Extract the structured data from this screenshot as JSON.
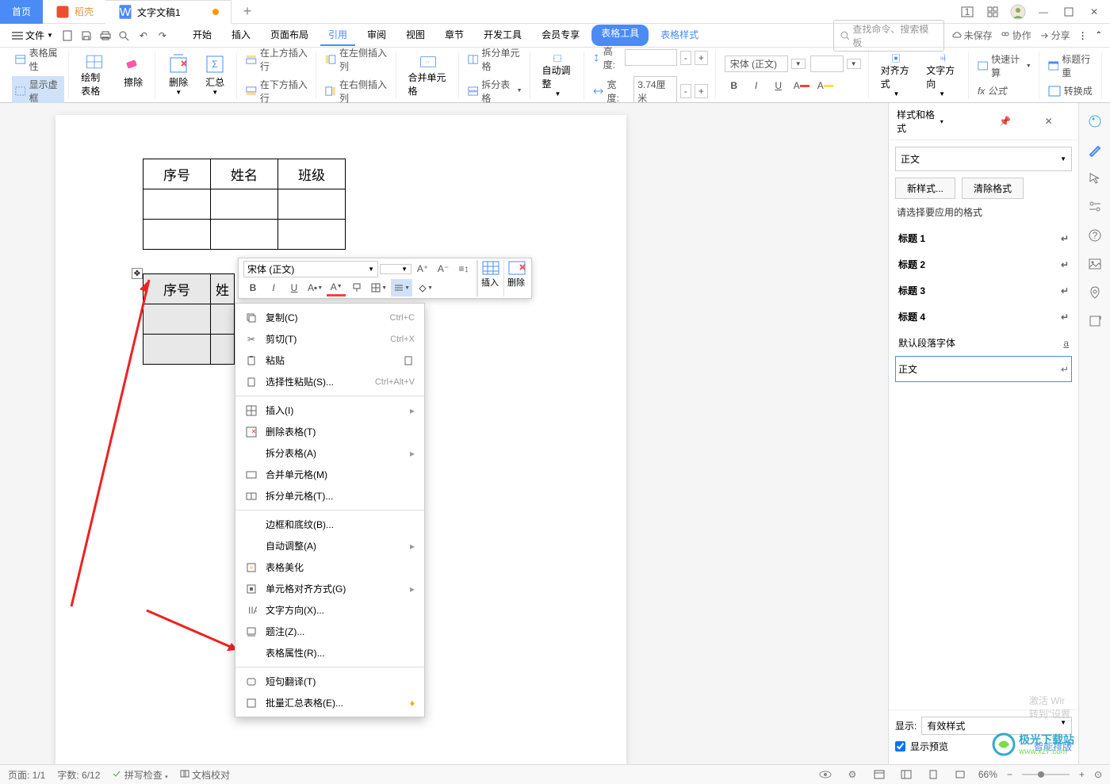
{
  "titlebar": {
    "home": "首页",
    "daoke": "稻壳",
    "doc_title": "文字文稿1",
    "add": "+"
  },
  "menubar": {
    "file": "文件",
    "tabs": [
      "开始",
      "插入",
      "页面布局",
      "引用",
      "审阅",
      "视图",
      "章节",
      "开发工具",
      "会员专享"
    ],
    "tool": "表格工具",
    "style": "表格样式",
    "search": "查找命令、搜索模板",
    "unsaved": "未保存",
    "coop": "协作",
    "share": "分享"
  },
  "ribbon": {
    "props": "表格属性",
    "vframe": "显示虚框",
    "draw": "绘制表格",
    "erase": "擦除",
    "delete": "删除",
    "summary": "汇总",
    "ins_above": "在上方插入行",
    "ins_below": "在下方插入行",
    "ins_left": "在左侧插入列",
    "ins_right": "在右侧插入列",
    "merge": "合并单元格",
    "split_cell": "拆分单元格",
    "split_table": "拆分表格",
    "autofit": "自动调整",
    "height": "高度:",
    "width": "宽度:",
    "width_val": "3.74厘米",
    "font": "宋体 (正文)",
    "align": "对齐方式",
    "direction": "文字方向",
    "fast_calc": "快速计算",
    "formula": "fx 公式",
    "title_row": "标题行重",
    "convert": "转换成"
  },
  "tables": {
    "headers": [
      "序号",
      "姓名",
      "班级"
    ],
    "t2_h1": "序号",
    "t2_h2": "姓"
  },
  "float": {
    "font": "宋体 (正文)",
    "insert": "插入",
    "delete": "删除"
  },
  "ctx": {
    "copy": "复制(C)",
    "copy_k": "Ctrl+C",
    "cut": "剪切(T)",
    "cut_k": "Ctrl+X",
    "paste": "粘贴",
    "paste_special": "选择性粘贴(S)...",
    "paste_special_k": "Ctrl+Alt+V",
    "insert": "插入(I)",
    "del_table": "删除表格(T)",
    "split_table": "拆分表格(A)",
    "merge": "合并单元格(M)",
    "split_cell": "拆分单元格(T)...",
    "border": "边框和底纹(B)...",
    "autofit": "自动调整(A)",
    "beautify": "表格美化",
    "cell_align": "单元格对齐方式(G)",
    "direction": "文字方向(X)...",
    "caption": "题注(Z)...",
    "table_props": "表格属性(R)...",
    "translate": "短句翻译(T)",
    "batch": "批量汇总表格(E)..."
  },
  "panel": {
    "title": "样式和格式",
    "current": "正文",
    "new_style": "新样式...",
    "clear": "清除格式",
    "prompt": "请选择要应用的格式",
    "h1": "标题 1",
    "h2": "标题 2",
    "h3": "标题 3",
    "h4": "标题 4",
    "default_font": "默认段落字体",
    "body": "正文",
    "show": "显示:",
    "valid": "有效样式",
    "preview": "显示预览",
    "smart": "智能排版"
  },
  "watermark": {
    "l1": "激活 Wir",
    "l2": "转到\"设置",
    "logo": "极光下载站",
    "url": "www.xz7.com"
  },
  "status": {
    "page": "页面: 1/1",
    "words": "字数: 6/12",
    "spell": "拼写检查",
    "compare": "文档校对",
    "zoom": "66%"
  }
}
